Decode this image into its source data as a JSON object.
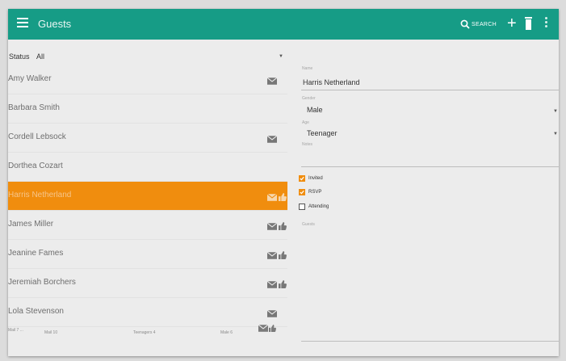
{
  "appbar": {
    "title": "Guests",
    "search_label": "SEARCH",
    "add_label": "+",
    "bg_color": "#169c86",
    "icons": [
      "menu-icon",
      "search-icon",
      "add-icon",
      "delete-icon",
      "more-vert-icon"
    ]
  },
  "filter": {
    "label": "Status",
    "value": "All"
  },
  "guests": [
    {
      "name": "Amy Walker",
      "mail": true,
      "thumb": false,
      "selected": false
    },
    {
      "name": "Barbara Smith",
      "mail": false,
      "thumb": false,
      "selected": false
    },
    {
      "name": "Cordell Lebsock",
      "mail": true,
      "thumb": false,
      "selected": false
    },
    {
      "name": "Dorthea Cozart",
      "mail": false,
      "thumb": false,
      "selected": false
    },
    {
      "name": "Harris Netherland",
      "mail": true,
      "thumb": true,
      "selected": true
    },
    {
      "name": "James Miller",
      "mail": true,
      "thumb": true,
      "selected": false
    },
    {
      "name": "Jeanine Fames",
      "mail": true,
      "thumb": true,
      "selected": false
    },
    {
      "name": "Jeremiah Borchers",
      "mail": true,
      "thumb": true,
      "selected": false
    },
    {
      "name": "Lola Stevenson",
      "mail": true,
      "thumb": false,
      "selected": false
    }
  ],
  "footer": {
    "total": "Mail 7 ...",
    "stat1": "Mail 10",
    "stat2": "Teenagers 4",
    "stat3": "Male 6"
  },
  "detail": {
    "name_caption": "Name",
    "name_value": "Harris Netherland",
    "gender_caption": "Gender",
    "gender_value": "Male",
    "age_caption": "Age",
    "age_value": "Teenager",
    "notes_caption": "Notes",
    "invited_label": "Invited",
    "invited": true,
    "rsvp_label": "RSVP",
    "rsvp": true,
    "attending_label": "Attending",
    "attending": false,
    "guests_caption": "Guests"
  },
  "colors": {
    "accent": "#f08d0e",
    "primary": "#169c86"
  }
}
